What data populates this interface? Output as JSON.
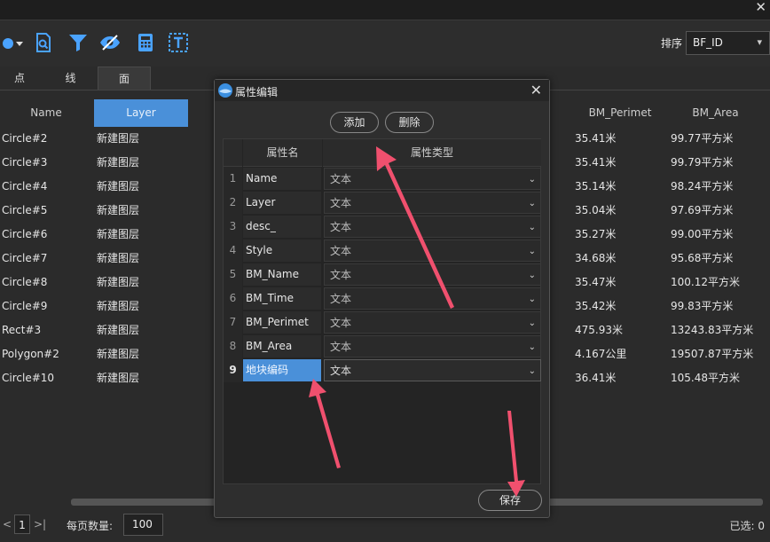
{
  "window": {
    "close_glyph": "✕"
  },
  "toolbar": {
    "icons": [
      "layers-dropdown-icon",
      "document-search-icon",
      "filter-icon",
      "hide-eye-icon",
      "calculator-icon",
      "text-box-icon"
    ],
    "sort_label": "排序",
    "sort_value": "BF_ID",
    "sort_chevron": "⌄"
  },
  "tabs": [
    {
      "label": "点"
    },
    {
      "label": "线"
    },
    {
      "label": "面",
      "active": true
    }
  ],
  "table": {
    "headers": [
      "Name",
      "Layer",
      "BM_Perimet",
      "BM_Area"
    ],
    "rows": [
      {
        "name": "Circle#2",
        "layer": "新建图层",
        "perimeter": "35.41米",
        "area": "99.77平方米"
      },
      {
        "name": "Circle#3",
        "layer": "新建图层",
        "perimeter": "35.41米",
        "area": "99.79平方米"
      },
      {
        "name": "Circle#4",
        "layer": "新建图层",
        "perimeter": "35.14米",
        "area": "98.24平方米"
      },
      {
        "name": "Circle#5",
        "layer": "新建图层",
        "perimeter": "35.04米",
        "area": "97.69平方米"
      },
      {
        "name": "Circle#6",
        "layer": "新建图层",
        "perimeter": "35.27米",
        "area": "99.00平方米"
      },
      {
        "name": "Circle#7",
        "layer": "新建图层",
        "perimeter": "34.68米",
        "area": "95.68平方米"
      },
      {
        "name": "Circle#8",
        "layer": "新建图层",
        "perimeter": "35.47米",
        "area": "100.12平方米"
      },
      {
        "name": "Circle#9",
        "layer": "新建图层",
        "perimeter": "35.42米",
        "area": "99.83平方米"
      },
      {
        "name": "Rect#3",
        "layer": "新建图层",
        "perimeter": "475.93米",
        "area": "13243.83平方米"
      },
      {
        "name": "Polygon#2",
        "layer": "新建图层",
        "perimeter": "4.167公里",
        "area": "19507.87平方米"
      },
      {
        "name": "Circle#10",
        "layer": "新建图层",
        "perimeter": "36.41米",
        "area": "105.48平方米"
      }
    ]
  },
  "footer": {
    "prev_glyph": "<",
    "page": "1",
    "next_glyph": ">|",
    "per_page_label": "每页数量:",
    "per_page_value": "100",
    "selected": "已选: 0"
  },
  "dialog": {
    "title": "属性编辑",
    "close_glyph": "✕",
    "add_label": "添加",
    "delete_label": "删除",
    "col_name": "属性名",
    "col_type": "属性类型",
    "rows": [
      {
        "num": "1",
        "name": "Name",
        "type": "文本"
      },
      {
        "num": "2",
        "name": "Layer",
        "type": "文本"
      },
      {
        "num": "3",
        "name": "desc_",
        "type": "文本"
      },
      {
        "num": "4",
        "name": "Style",
        "type": "文本"
      },
      {
        "num": "5",
        "name": "BM_Name",
        "type": "文本"
      },
      {
        "num": "6",
        "name": "BM_Time",
        "type": "文本"
      },
      {
        "num": "7",
        "name": "BM_Perimet",
        "type": "文本"
      },
      {
        "num": "8",
        "name": "BM_Area",
        "type": "文本"
      },
      {
        "num": "9",
        "name": "地块编码",
        "type": "文本",
        "selected": true
      }
    ],
    "save_label": "保存"
  },
  "colors": {
    "accent": "#4a90d9",
    "arrow": "#f0506e",
    "background": "#2b2b2b"
  }
}
